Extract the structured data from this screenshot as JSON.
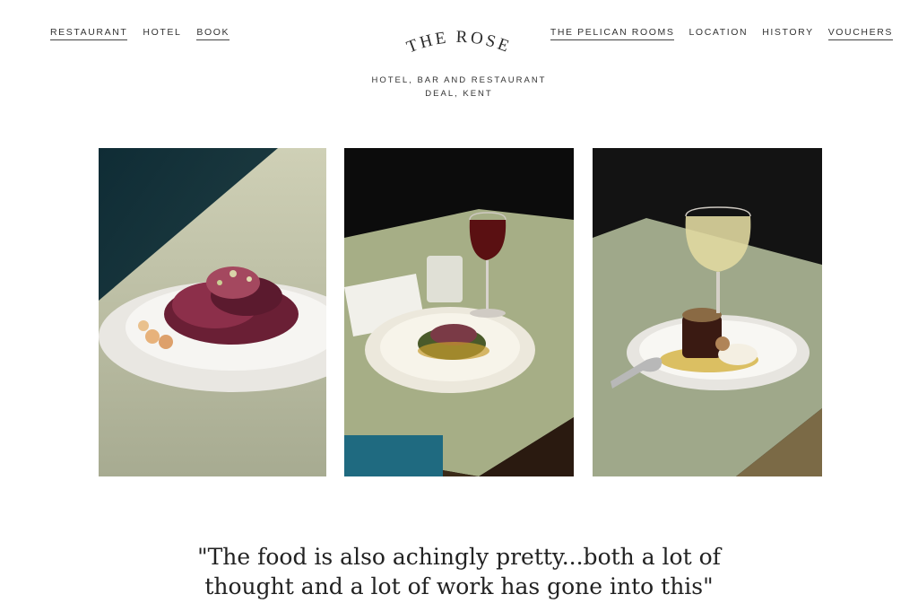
{
  "nav_left": [
    {
      "label": "RESTAURANT",
      "underlined": true
    },
    {
      "label": "HOTEL",
      "underlined": false
    },
    {
      "label": "BOOK",
      "underlined": true
    }
  ],
  "nav_right": [
    {
      "label": "THE PELICAN ROOMS",
      "underlined": true
    },
    {
      "label": "LOCATION",
      "underlined": false
    },
    {
      "label": "HISTORY",
      "underlined": false
    },
    {
      "label": "VOUCHERS",
      "underlined": true
    }
  ],
  "logo": {
    "title": "THE ROSE",
    "subtitle_line1": "HOTEL, BAR AND RESTAURANT",
    "subtitle_line2": "DEAL, KENT"
  },
  "gallery": [
    {
      "name": "photo-dish-radicchio"
    },
    {
      "name": "photo-dish-wine-table"
    },
    {
      "name": "photo-dish-dessert"
    }
  ],
  "quote": {
    "line1": "\"The food is also achingly pretty...both a lot of",
    "line2": "thought and a lot of work has gone into this\""
  },
  "colors": {
    "background": "#ffffff",
    "text": "#2a2a2a",
    "table_green": "#a4ad86"
  }
}
